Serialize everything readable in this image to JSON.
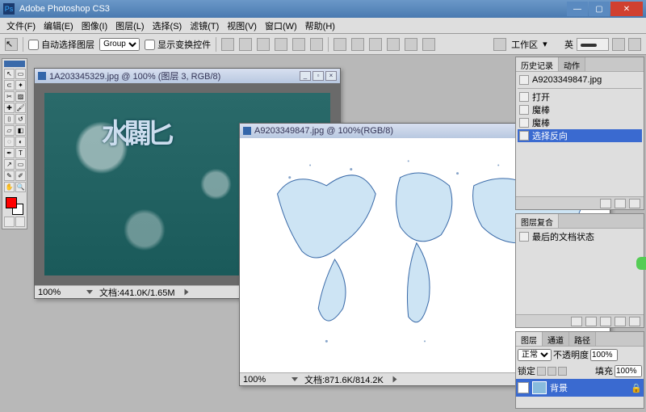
{
  "app": {
    "title": "Adobe Photoshop CS3",
    "icon_label": "Ps"
  },
  "window_buttons": {
    "min": "—",
    "max": "▢",
    "close": "✕"
  },
  "menu": [
    "文件(F)",
    "编辑(E)",
    "图像(I)",
    "图层(L)",
    "选择(S)",
    "滤镜(T)",
    "视图(V)",
    "窗口(W)",
    "帮助(H)"
  ],
  "options": {
    "auto_select_label": "自动选择图层",
    "group_label": "Group",
    "show_transform_label": "显示变换控件",
    "workspace_label": "工作区",
    "ime_label": "英"
  },
  "doc1": {
    "title": "1A203345329.jpg @ 100% (图层 3, RGB/8)",
    "zoom": "100%",
    "status": "文档:441.0K/1.65M",
    "overlay_text": "水闢匕"
  },
  "doc2": {
    "title": "A9203349847.jpg @ 100%(RGB/8)",
    "zoom": "100%",
    "status": "文档:871.6K/814.2K"
  },
  "history": {
    "tab1": "历史记录",
    "tab2": "动作",
    "source": "A9203349847.jpg",
    "items": [
      "打开",
      "魔棒",
      "魔棒",
      "选择反向"
    ]
  },
  "toolpresets": {
    "tab": "图层复合",
    "body": "最后的文档状态"
  },
  "layers": {
    "tabs": [
      "图层",
      "通道",
      "路径"
    ],
    "blend": "正常",
    "opacity_label": "不透明度",
    "opacity": "100%",
    "lock_label": "锁定",
    "fill_label": "填充",
    "fill": "100%",
    "layer_name": "背景"
  }
}
